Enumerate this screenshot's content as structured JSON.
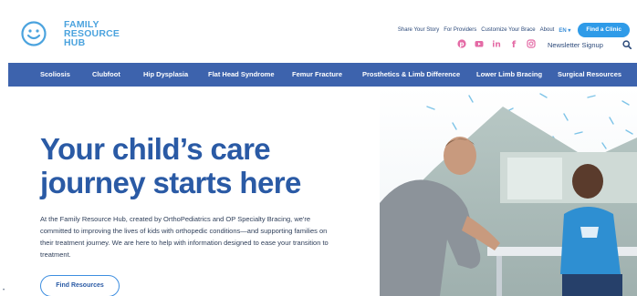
{
  "logo": {
    "line1": "FAMILY",
    "line2": "RESOURCE",
    "line3": "HUB",
    "icon": "smiley-face-icon"
  },
  "top_links": [
    "Share Your Story",
    "For Providers",
    "Customize Your Brace",
    "About"
  ],
  "language": "EN ▾",
  "find_clinic_label": "Find a Clinic",
  "social_icons": [
    "pinterest-icon",
    "youtube-icon",
    "linkedin-icon",
    "facebook-icon",
    "instagram-icon"
  ],
  "newsletter_label": "Newsletter Signup",
  "nav": [
    "Scoliosis",
    "Clubfoot",
    "Hip Dysplasia",
    "Flat Head Syndrome",
    "Femur Fracture",
    "Prosthetics & Limb Difference",
    "Lower Limb Bracing",
    "Surgical Resources"
  ],
  "hero": {
    "title_line1": "Your child’s care",
    "title_line2": "journey starts here",
    "body": "At the Family Resource Hub, created by OrthoPediatrics and OP Specialty Bracing, we're committed to improving the lives of kids with orthopedic conditions—and supporting families on their treatment journey. We are here to help with information designed to ease your transition to treatment.",
    "cta_label": "Find Resources"
  },
  "colors": {
    "brand_blue": "#2a5aa5",
    "nav_bg": "#3d63ad",
    "accent": "#2f9be8",
    "social": "#e46aa5"
  }
}
